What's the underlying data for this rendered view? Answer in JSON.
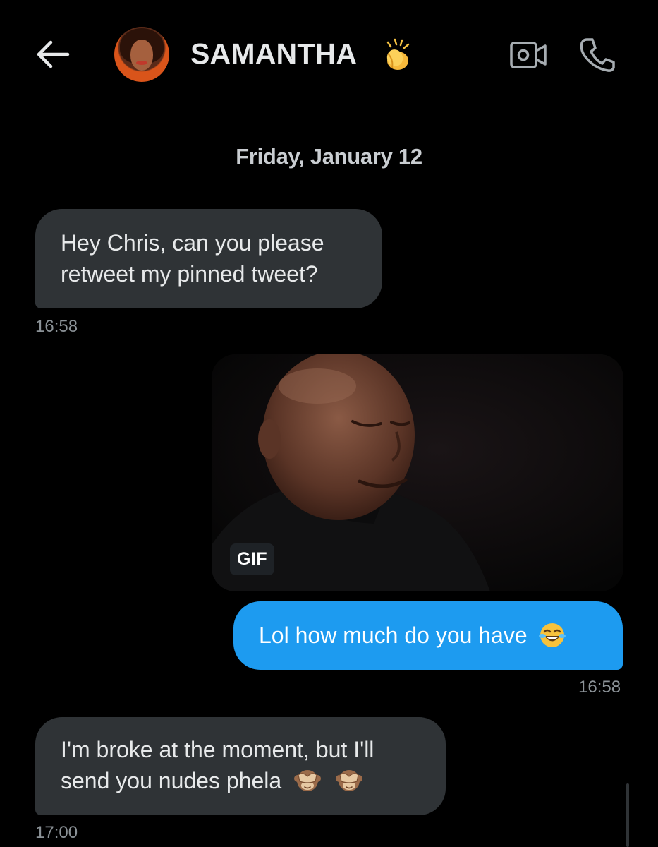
{
  "header": {
    "contact_name": "SAMANTHA",
    "name_emoji": "clapping-hands-icon",
    "back_icon": "arrow-left-icon",
    "video_icon": "video-camera-icon",
    "call_icon": "phone-icon"
  },
  "conversation": {
    "date_separator": "Friday, January 12",
    "messages": [
      {
        "direction": "incoming",
        "lines": [
          "Hey Chris, can you please",
          "retweet my pinned tweet?"
        ],
        "time": "16:58"
      },
      {
        "direction": "outgoing",
        "type": "gif",
        "gif_label": "GIF"
      },
      {
        "direction": "outgoing",
        "text": "Lol how much do you have",
        "emoji": "face-with-tears-of-joy-icon",
        "time": "16:58"
      },
      {
        "direction": "incoming",
        "lines": [
          "I'm broke at the moment, but I'll",
          "send you nudes phela"
        ],
        "emoji": "see-no-evil-monkey-icon",
        "time": "17:00"
      }
    ]
  },
  "colors": {
    "background": "#000000",
    "incoming_bubble": "#2f3336",
    "outgoing_bubble": "#1d9bf0",
    "timestamp": "#8b9297"
  }
}
